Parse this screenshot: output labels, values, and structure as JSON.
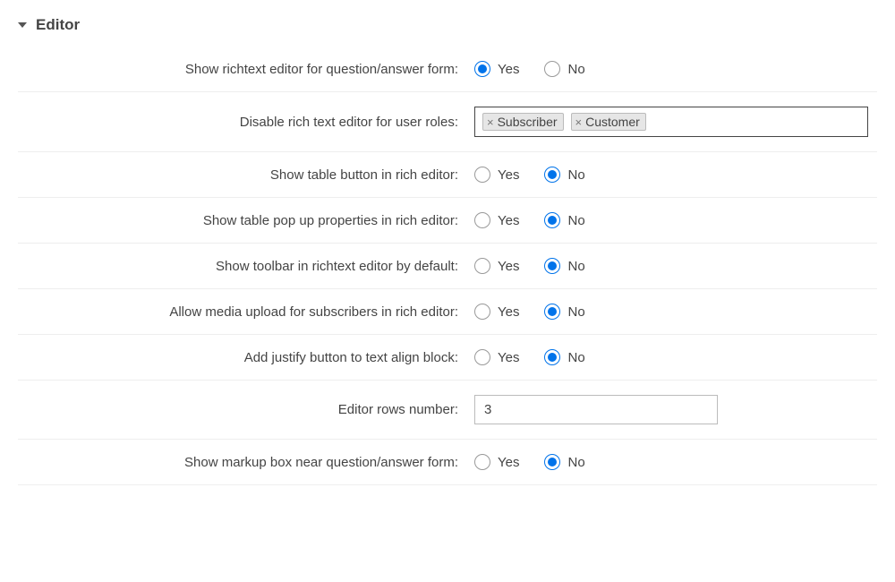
{
  "section": {
    "title": "Editor"
  },
  "common": {
    "yes": "Yes",
    "no": "No"
  },
  "rows": {
    "show_richtext": {
      "label": "Show richtext editor for question/answer form:",
      "value": "yes"
    },
    "disable_roles": {
      "label": "Disable rich text editor for user roles:",
      "tags": [
        "Subscriber",
        "Customer"
      ]
    },
    "show_table_button": {
      "label": "Show table button in rich editor:",
      "value": "no"
    },
    "show_table_popup": {
      "label": "Show table pop up properties in rich editor:",
      "value": "no"
    },
    "show_toolbar_default": {
      "label": "Show toolbar in richtext editor by default:",
      "value": "no"
    },
    "allow_media_upload": {
      "label": "Allow media upload for subscribers in rich editor:",
      "value": "no"
    },
    "add_justify_button": {
      "label": "Add justify button to text align block:",
      "value": "no"
    },
    "editor_rows": {
      "label": "Editor rows number:",
      "value": "3"
    },
    "show_markup_box": {
      "label": "Show markup box near question/answer form:",
      "value": "no"
    }
  }
}
